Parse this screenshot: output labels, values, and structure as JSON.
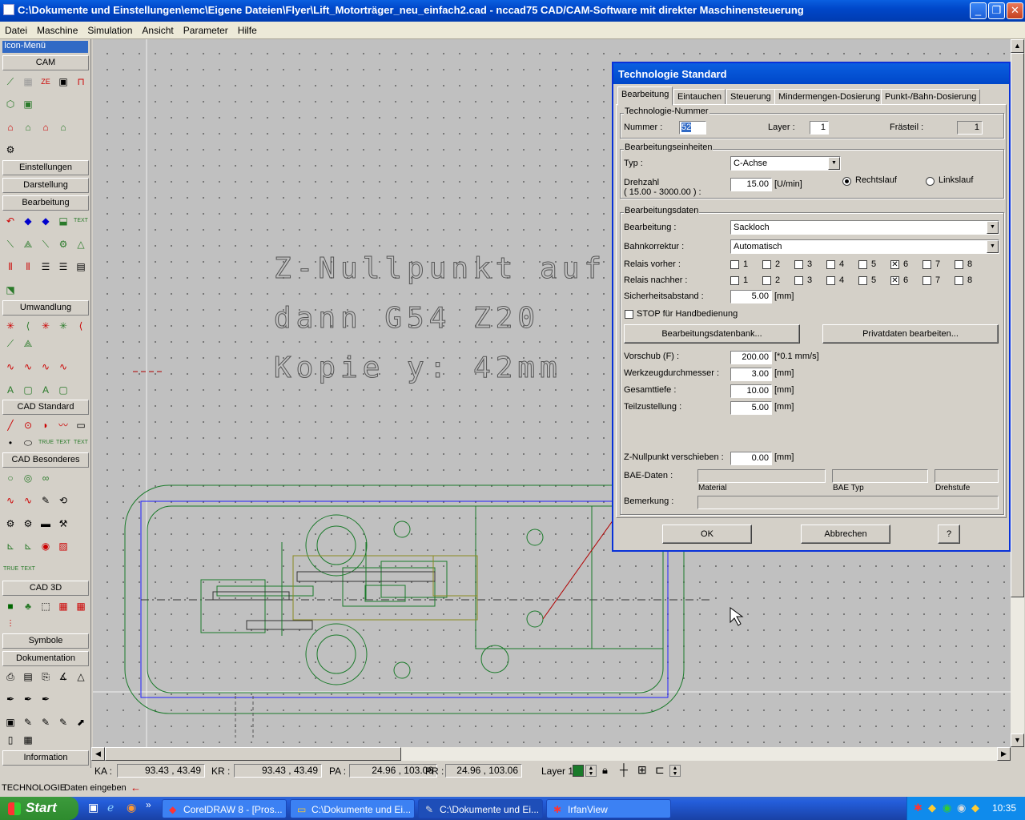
{
  "window": {
    "title": "C:\\Dokumente und Einstellungen\\emc\\Eigene Dateien\\Flyer\\Lift_Motorträger_neu_einfach2.cad - nccad75  CAD/CAM-Software mit direkter Maschinensteuerung",
    "minimize": "_",
    "maximize": "❐",
    "close": "✕"
  },
  "menu": [
    "Datei",
    "Maschine",
    "Simulation",
    "Ansicht",
    "Parameter",
    "Hilfe"
  ],
  "leftpanel": {
    "selected": "Icon-Menü",
    "sections": [
      "CAM",
      "Einstellungen",
      "Darstellung",
      "Bearbeitung",
      "Umwandlung",
      "CAD Standard",
      "CAD Besonderes",
      "CAD 3D",
      "Symbole",
      "Dokumentation",
      "Information"
    ]
  },
  "canvas": {
    "text_lines": [
      "Z-Nullpunkt auf Unte",
      "dann G54 Z20",
      "Kopie y: 42mm"
    ]
  },
  "dialog": {
    "title": "Technologie Standard",
    "tabs": [
      "Bearbeitung",
      "Eintauchen",
      "Steuerung",
      "Mindermengen-Dosierung",
      "Punkt-/Bahn-Dosierung"
    ],
    "technologie_nummer": {
      "group": "Technologie-Nummer",
      "nummer_label": "Nummer :",
      "nummer_value": "52",
      "layer_label": "Layer :",
      "layer_value": "1",
      "frasteil_label": "Frästeil :",
      "frasteil_value": "1"
    },
    "einheiten": {
      "group": "Bearbeitungseinheiten",
      "typ_label": "Typ :",
      "typ_value": "C-Achse",
      "drehzahl_label": "Drehzahl",
      "drehzahl_range": "( 15.00 - 3000.00 ) :",
      "drehzahl_value": "15.00",
      "drehzahl_unit": "[U/min]",
      "rechtslauf": "Rechtslauf",
      "linkslauf": "Linkslauf"
    },
    "daten": {
      "group": "Bearbeitungsdaten",
      "bearbeitung_label": "Bearbeitung :",
      "bearbeitung_value": "Sackloch",
      "bahnkorrektur_label": "Bahnkorrektur :",
      "bahnkorrektur_value": "Automatisch",
      "relais_vorher_label": "Relais vorher :",
      "relais_nachher_label": "Relais nachher :",
      "relais_numbers": [
        "1",
        "2",
        "3",
        "4",
        "5",
        "6",
        "7",
        "8"
      ],
      "relais_vorher_checked": [
        false,
        false,
        false,
        false,
        false,
        true,
        false,
        false
      ],
      "relais_nachher_checked": [
        false,
        false,
        false,
        false,
        false,
        true,
        false,
        false
      ],
      "sicherheit_label": "Sicherheitsabstand :",
      "sicherheit_value": "5.00",
      "mm": "[mm]",
      "stop_label": "STOP für Handbedienung",
      "btn_datenbank": "Bearbeitungsdatenbank...",
      "btn_privat": "Privatdaten bearbeiten...",
      "vorschub_label": "Vorschub (F) :",
      "vorschub_value": "200.00",
      "vorschub_unit": "[*0.1 mm/s]",
      "werkzeug_label": "Werkzeugdurchmesser :",
      "werkzeug_value": "3.00",
      "gesamttiefe_label": "Gesamttiefe :",
      "gesamttiefe_value": "10.00",
      "teilzustellung_label": "Teilzustellung :",
      "teilzustellung_value": "5.00",
      "znull_label": "Z-Nullpunkt verschieben :",
      "znull_value": "0.00",
      "bae_label": "BAE-Daten :",
      "material_label": "Material",
      "baetyp_label": "BAE Typ",
      "drehstufe_label": "Drehstufe",
      "bemerkung_label": "Bemerkung :"
    },
    "ok": "OK",
    "abbrechen": "Abbrechen",
    "help": "?"
  },
  "statusbar": {
    "ka_label": "KA :",
    "ka_value": "93.43 , 43.49",
    "kr_label": "KR :",
    "kr_value": "93.43 , 43.49",
    "pa_label": "PA :",
    "pa_value": "24.96 , 103.06",
    "pr_label": "PR :",
    "pr_value": "24.96 , 103.06",
    "layer_label": "Layer 1"
  },
  "bottombar": {
    "mode": "TECHNOLOGIE",
    "prompt": "Daten eingeben"
  },
  "taskbar": {
    "start": "Start",
    "tasks": [
      "CorelDRAW 8 - [Pros...",
      "C:\\Dokumente und Ei...",
      "C:\\Dokumente und Ei...",
      "IrfanView"
    ],
    "clock": "10:35"
  },
  "colors": {
    "accent": "#0831d9",
    "drawing_green": "#1a7a2a",
    "drawing_blue": "#2020ff",
    "drawing_red": "#b00000",
    "drawing_olive": "#8a8a20"
  }
}
